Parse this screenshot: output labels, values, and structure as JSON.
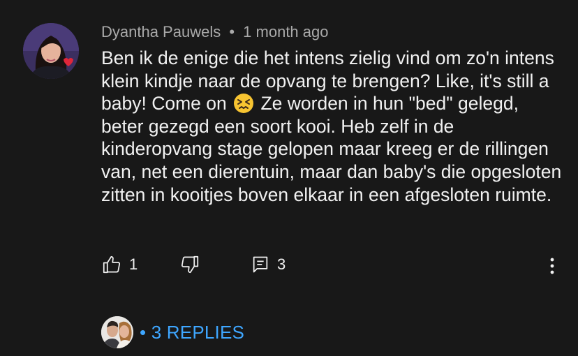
{
  "comment": {
    "author": "Dyantha Pauwels",
    "separator": "•",
    "timestamp": "1 month ago",
    "text_part1": "Ben ik de enige die het intens zielig vind om zo'n intens klein kindje naar de opvang te brengen? Like, it's still a baby! Come on",
    "emoji_icon": "confounded-face-emoji",
    "text_part2": "Ze worden in hun \"bed\" gelegd, beter gezegd een soort kooi. Heb zelf in de kinderopvang stage gelopen maar kreeg er de rillingen van, net een dierentuin, maar dan baby's die opgesloten zitten in kooitjes boven elkaar in een afgesloten ruimte."
  },
  "actions": {
    "like_icon": "thumbs-up-icon",
    "like_count": "1",
    "dislike_icon": "thumbs-down-icon",
    "reply_icon": "comment-icon",
    "reply_count": "3",
    "more_icon": "more-vertical-icon"
  },
  "replies": {
    "toggle_label": "• 3 REPLIES"
  },
  "colors": {
    "background": "#181818",
    "text": "#f1f1f1",
    "meta": "#aaaaaa",
    "link": "#3ea6ff"
  }
}
